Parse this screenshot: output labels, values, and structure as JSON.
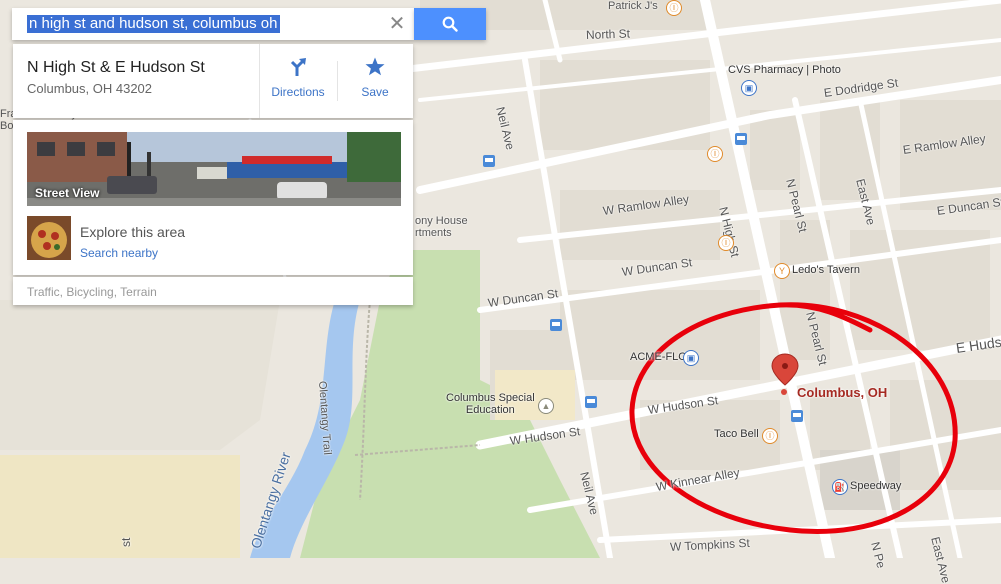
{
  "search": {
    "query": "n high st and hudson st, columbus oh"
  },
  "place": {
    "name": "N High St & E Hudson St",
    "address": "Columbus, OH 43202",
    "directions_label": "Directions",
    "save_label": "Save"
  },
  "explore": {
    "street_view_label": "Street View",
    "title": "Explore this area",
    "link": "Search nearby"
  },
  "layers": {
    "label": "Traffic, Bicycling, Terrain"
  },
  "map": {
    "marker_label": "Columbus, OH",
    "partial_label_franklin": "Franklin County\nBo",
    "streets": {
      "north_st": "North St",
      "e_dodridge": "E Dodridge St",
      "e_ramlow_alley": "E Ramlow Alley",
      "w_ramlow_alley": "W Ramlow Alley",
      "e_duncan": "E Duncan St",
      "w_duncan_1": "W Duncan St",
      "w_duncan_2": "W Duncan St",
      "e_hudson": "E Huds",
      "w_hudson_1": "W Hudson St",
      "w_hudson_2": "W Hudson St",
      "w_kinnear": "W Kinnear Alley",
      "w_tompkins": "W Tompkins St",
      "n_high": "N High St",
      "n_pearl_1": "N Pearl St",
      "n_pearl_2": "N Pearl St",
      "n_pearl_3": "N Pe",
      "neil_1": "Neil Ave",
      "neil_2": "Neil Ave",
      "east_ave_1": "East Ave",
      "east_ave_2": "East Ave",
      "olentangy_trail": "Olentangy Trail",
      "olentangy_river": "Olentangy River",
      "left_st": "st",
      "apartments": "ony House\nrtments"
    },
    "pois": {
      "patrick": "Patrick J's",
      "cvs": "CVS Pharmacy | Photo",
      "ledos": "Ledo's Tavern",
      "acme": "ACME-FLO",
      "columbus_special": "Columbus Special\nEducation",
      "taco_bell": "Taco Bell",
      "speedway": "Speedway"
    },
    "colors": {
      "road": "#ffffff",
      "block": "#e2ddd3",
      "park": "#c8dfb0",
      "water": "#a5c7ef",
      "circle": "#e8000b",
      "marker": "#d9463a"
    }
  }
}
